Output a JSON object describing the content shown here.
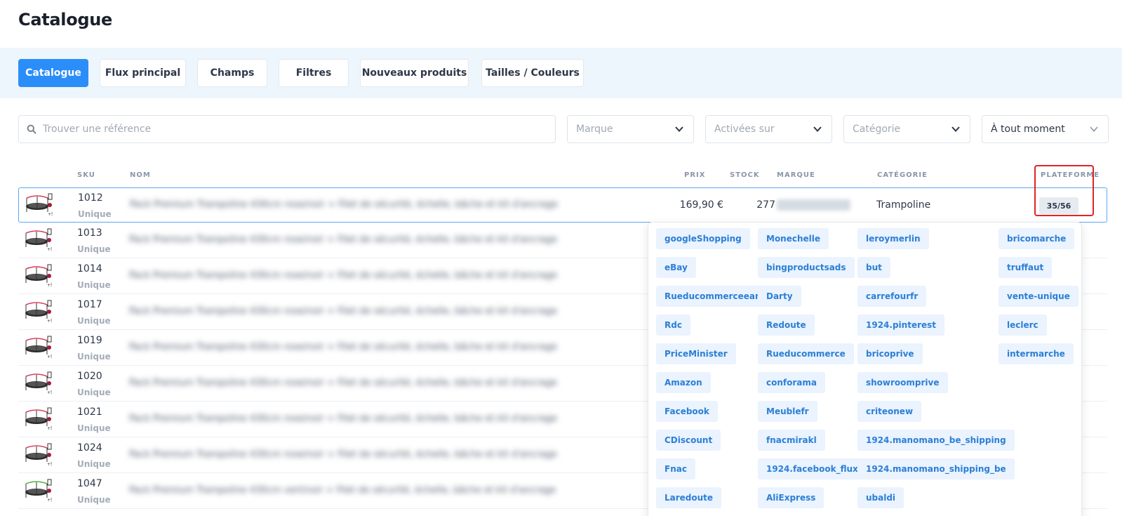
{
  "page": {
    "title": "Catalogue"
  },
  "tabs": [
    {
      "label": "Catalogue",
      "active": true
    },
    {
      "label": "Flux principal",
      "active": false
    },
    {
      "label": "Champs",
      "active": false
    },
    {
      "label": "Filtres",
      "active": false
    },
    {
      "label": "Nouveaux produits",
      "active": false
    },
    {
      "label": "Tailles / Couleurs",
      "active": false
    }
  ],
  "filters": {
    "search_placeholder": "Trouver une référence",
    "brand_placeholder": "Marque",
    "activated_placeholder": "Activées sur",
    "category_placeholder": "Catégorie",
    "period_value": "À tout moment"
  },
  "table": {
    "headers": {
      "sku": "SKU",
      "name": "NOM",
      "price": "PRIX",
      "stock": "STOCK",
      "brand": "MARQUE",
      "category": "CATÉGORIE",
      "platform": "PLATEFORME"
    },
    "rows": [
      {
        "sku": "1012",
        "variant": "Unique",
        "name": "Pack Premium Trampoline 430cm rose/noir + Filet de sécurité, échelle, bâche et kit d'ancrage",
        "price": "169,90 €",
        "stock": "277",
        "category": "Trampoline",
        "platforms": "35/56",
        "color": "#d63a5a"
      },
      {
        "sku": "1013",
        "variant": "Unique",
        "name": "Pack Premium Trampoline 430cm rose/noir + Filet de sécurité, échelle, bâche et kit d'ancrage",
        "color": "#d63a5a"
      },
      {
        "sku": "1014",
        "variant": "Unique",
        "name": "Pack Premium Trampoline 430cm rose/noir + Filet de sécurité, échelle, bâche et kit d'ancrage",
        "color": "#d63a5a"
      },
      {
        "sku": "1017",
        "variant": "Unique",
        "name": "Pack Premium Trampoline 430cm rose/noir + Filet de sécurité, échelle, bâche et kit d'ancrage",
        "color": "#d63a5a"
      },
      {
        "sku": "1019",
        "variant": "Unique",
        "name": "Pack Premium Trampoline 430cm rose/noir + Filet de sécurité, échelle, bâche et kit d'ancrage",
        "color": "#d63a5a"
      },
      {
        "sku": "1020",
        "variant": "Unique",
        "name": "Pack Premium Trampoline 430cm rose/noir + Filet de sécurité, échelle, bâche et kit d'ancrage",
        "color": "#d63a5a"
      },
      {
        "sku": "1021",
        "variant": "Unique",
        "name": "Pack Premium Trampoline 430cm rose/noir + Filet de sécurité, échelle, bâche et kit d'ancrage",
        "color": "#d63a5a"
      },
      {
        "sku": "1024",
        "variant": "Unique",
        "name": "Pack Premium Trampoline 430cm rose/noir + Filet de sécurité, échelle, bâche et kit d'ancrage",
        "color": "#d63a5a"
      },
      {
        "sku": "1047",
        "variant": "Unique",
        "name": "Pack Premium Trampoline 430cm vert/noir + Filet de sécurité, échelle, bâche et kit d'ancrage",
        "color": "#4caf3a"
      }
    ]
  },
  "platforms": [
    [
      "googleShopping",
      "Monechelle",
      "leroymerlin",
      "bricomarche"
    ],
    [
      "eBay",
      "bingproductsads",
      "but",
      "truffaut"
    ],
    [
      "Rueducommerceean",
      "Darty",
      "carrefourfr",
      "vente-unique"
    ],
    [
      "Rdc",
      "Redoute",
      "1924.pinterest",
      "leclerc"
    ],
    [
      "PriceMinister",
      "Rueducommerce",
      "bricoprive",
      "intermarche"
    ],
    [
      "Amazon",
      "conforama",
      "showroomprive"
    ],
    [
      "Facebook",
      "Meublefr",
      "criteonew"
    ],
    [
      "CDiscount",
      "fnacmirakl",
      "1924.manomano_be_shipping"
    ],
    [
      "Fnac",
      "1924.facebook_flux",
      "1924.manomano_shipping_be"
    ],
    [
      "Laredoute",
      "AliExpress",
      "ubaldi"
    ]
  ],
  "colors": {
    "accent": "#2b8ef8",
    "highlight": "#e02424",
    "chip_bg": "#eaf3fe",
    "chip_text": "#2b7fd6"
  },
  "icons": {
    "search": "search-icon",
    "chevron": "chevron-down-icon"
  }
}
